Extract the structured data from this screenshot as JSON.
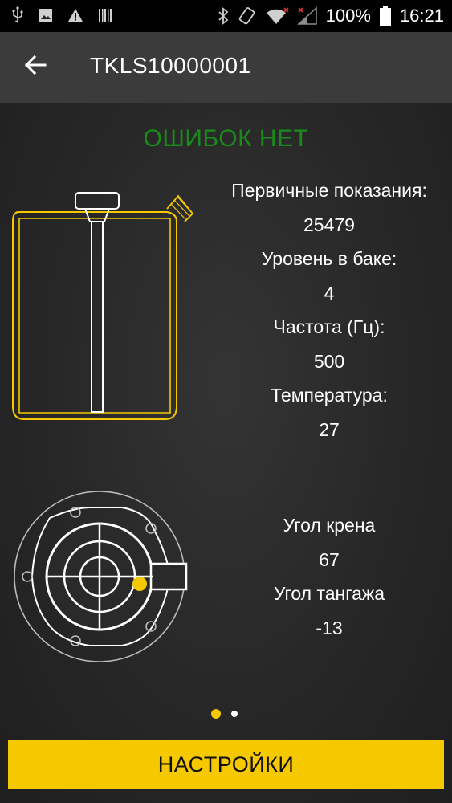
{
  "status_bar": {
    "battery": "100%",
    "time": "16:21"
  },
  "app_bar": {
    "title": "TKLS10000001"
  },
  "status": "ОШИБОК НЕТ",
  "tank_readings": [
    "Первичные показания:",
    "25479",
    "Уровень в баке:",
    "4",
    "Частота (Гц):",
    "500",
    "Температура:",
    "27"
  ],
  "tilt_readings": [
    "Угол крена",
    "67",
    "Угол тангажа",
    "-13"
  ],
  "pager": {
    "pages": 2,
    "active": 1
  },
  "button": {
    "label": "НАСТРОЙКИ"
  },
  "colors": {
    "accent": "#f5c800",
    "ok": "#1a8a1a"
  }
}
